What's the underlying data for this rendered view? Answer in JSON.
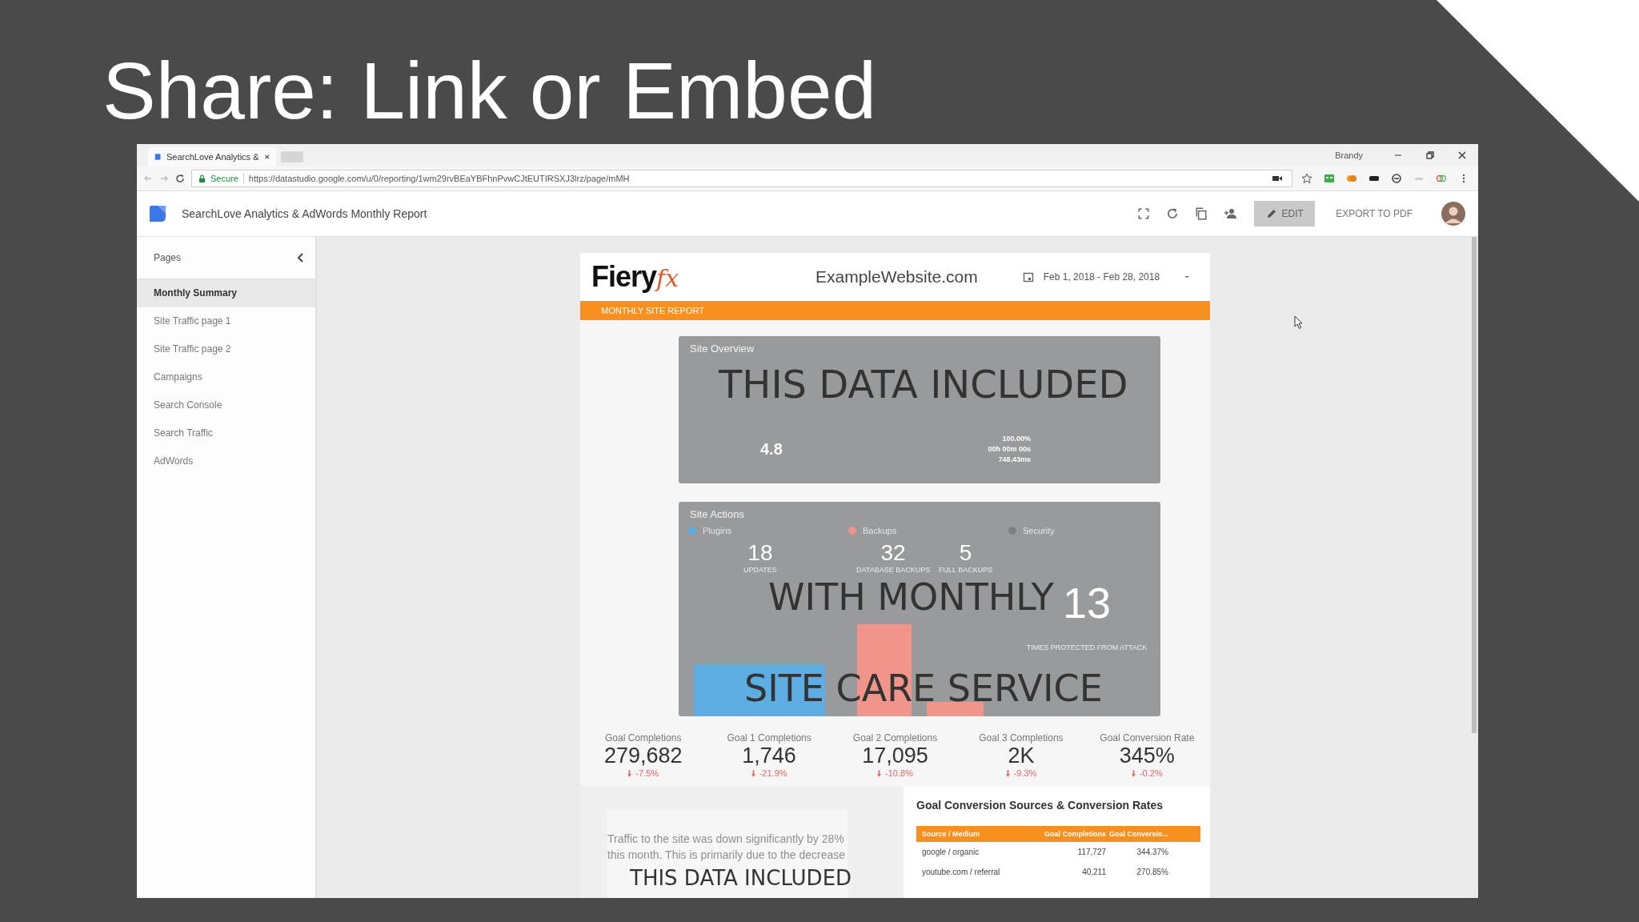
{
  "slide": {
    "title": "Share: Link or Embed"
  },
  "browser": {
    "tab_title": "SearchLove Analytics & ",
    "user": "Brandy",
    "secure_label": "Secure",
    "url": "https://datastudio.google.com/u/0/reporting/1wm29rvBEaYBFhnPvwCJtEUTIRSXJ3lrz/page/mMH"
  },
  "app": {
    "title": "SearchLove Analytics & AdWords Monthly Report",
    "edit": "EDIT",
    "export": "EXPORT TO PDF"
  },
  "sidebar": {
    "heading": "Pages",
    "items": [
      {
        "label": "Monthly Summary",
        "selected": true
      },
      {
        "label": "Site Traffic page 1",
        "selected": false
      },
      {
        "label": "Site Traffic page 2",
        "selected": false
      },
      {
        "label": "Campaigns",
        "selected": false
      },
      {
        "label": "Search Console",
        "selected": false
      },
      {
        "label": "Search Traffic",
        "selected": false
      },
      {
        "label": "AdWords",
        "selected": false
      }
    ]
  },
  "report": {
    "logo": {
      "text": "Fiery",
      "accent": "fx"
    },
    "site": "ExampleWebsite.com",
    "date_range": "Feb 1, 2018 - Feb 28, 2018",
    "banner": "MONTHLY SITE REPORT",
    "overview": {
      "title": "Site Overview",
      "caption": "THIS DATA INCLUDED",
      "wp_value": "4.8",
      "metrics": [
        "100.00%",
        "00h 00m 00s",
        "748.43ms"
      ]
    },
    "actions": {
      "title": "Site Actions",
      "captions": [
        "WITH MONTHLY",
        "SITE CARE SERVICE"
      ],
      "legend": [
        {
          "label": "Plugins",
          "color": "#5dade2"
        },
        {
          "label": "Backups",
          "color": "#f1948a"
        },
        {
          "label": "Security",
          "color": "#7f7f7f"
        }
      ],
      "stats": [
        {
          "value": "18",
          "label": "UPDATES"
        },
        {
          "value": "32",
          "label": "DATABASE BACKUPS"
        },
        {
          "value": "5",
          "label": "FULL BACKUPS"
        }
      ],
      "attack": {
        "value": "13",
        "label": "TIMES PROTECTED FROM ATTACK"
      }
    },
    "kpis": [
      {
        "label": "Goal Completions",
        "value": "279,682",
        "change": "-7.5%"
      },
      {
        "label": "Goal 1 Completions",
        "value": "1,746",
        "change": "-21.9%"
      },
      {
        "label": "Goal 2 Completions",
        "value": "17,095",
        "change": "-10.8%"
      },
      {
        "label": "Goal 3 Completions",
        "value": "2K",
        "change": "-9.3%"
      },
      {
        "label": "Goal Conversion Rate",
        "value": "345%",
        "change": "-0.2%"
      }
    ],
    "summary": {
      "text": "Traffic to the site was down significantly by 28% this month. This is primarily due to the decrease",
      "caption": "THIS DATA INCLUDED"
    },
    "table": {
      "title": "Goal Conversion Sources & Conversion Rates",
      "columns": [
        "Source / Medium",
        "Goal Completions",
        "Goal Conversio..."
      ],
      "rows": [
        [
          "google / organic",
          "117,727",
          "344.37%"
        ],
        [
          "youtube.com / referral",
          "40,211",
          "270.85%"
        ]
      ]
    }
  }
}
